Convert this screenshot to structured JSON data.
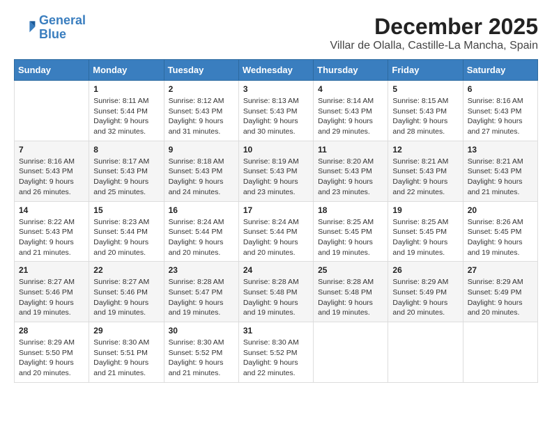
{
  "logo": {
    "line1": "General",
    "line2": "Blue"
  },
  "title": "December 2025",
  "location": "Villar de Olalla, Castille-La Mancha, Spain",
  "days_of_week": [
    "Sunday",
    "Monday",
    "Tuesday",
    "Wednesday",
    "Thursday",
    "Friday",
    "Saturday"
  ],
  "weeks": [
    [
      {
        "day": "",
        "sunrise": "",
        "sunset": "",
        "daylight": ""
      },
      {
        "day": "1",
        "sunrise": "Sunrise: 8:11 AM",
        "sunset": "Sunset: 5:44 PM",
        "daylight": "Daylight: 9 hours and 32 minutes."
      },
      {
        "day": "2",
        "sunrise": "Sunrise: 8:12 AM",
        "sunset": "Sunset: 5:43 PM",
        "daylight": "Daylight: 9 hours and 31 minutes."
      },
      {
        "day": "3",
        "sunrise": "Sunrise: 8:13 AM",
        "sunset": "Sunset: 5:43 PM",
        "daylight": "Daylight: 9 hours and 30 minutes."
      },
      {
        "day": "4",
        "sunrise": "Sunrise: 8:14 AM",
        "sunset": "Sunset: 5:43 PM",
        "daylight": "Daylight: 9 hours and 29 minutes."
      },
      {
        "day": "5",
        "sunrise": "Sunrise: 8:15 AM",
        "sunset": "Sunset: 5:43 PM",
        "daylight": "Daylight: 9 hours and 28 minutes."
      },
      {
        "day": "6",
        "sunrise": "Sunrise: 8:16 AM",
        "sunset": "Sunset: 5:43 PM",
        "daylight": "Daylight: 9 hours and 27 minutes."
      }
    ],
    [
      {
        "day": "7",
        "sunrise": "Sunrise: 8:16 AM",
        "sunset": "Sunset: 5:43 PM",
        "daylight": "Daylight: 9 hours and 26 minutes."
      },
      {
        "day": "8",
        "sunrise": "Sunrise: 8:17 AM",
        "sunset": "Sunset: 5:43 PM",
        "daylight": "Daylight: 9 hours and 25 minutes."
      },
      {
        "day": "9",
        "sunrise": "Sunrise: 8:18 AM",
        "sunset": "Sunset: 5:43 PM",
        "daylight": "Daylight: 9 hours and 24 minutes."
      },
      {
        "day": "10",
        "sunrise": "Sunrise: 8:19 AM",
        "sunset": "Sunset: 5:43 PM",
        "daylight": "Daylight: 9 hours and 23 minutes."
      },
      {
        "day": "11",
        "sunrise": "Sunrise: 8:20 AM",
        "sunset": "Sunset: 5:43 PM",
        "daylight": "Daylight: 9 hours and 23 minutes."
      },
      {
        "day": "12",
        "sunrise": "Sunrise: 8:21 AM",
        "sunset": "Sunset: 5:43 PM",
        "daylight": "Daylight: 9 hours and 22 minutes."
      },
      {
        "day": "13",
        "sunrise": "Sunrise: 8:21 AM",
        "sunset": "Sunset: 5:43 PM",
        "daylight": "Daylight: 9 hours and 21 minutes."
      }
    ],
    [
      {
        "day": "14",
        "sunrise": "Sunrise: 8:22 AM",
        "sunset": "Sunset: 5:43 PM",
        "daylight": "Daylight: 9 hours and 21 minutes."
      },
      {
        "day": "15",
        "sunrise": "Sunrise: 8:23 AM",
        "sunset": "Sunset: 5:44 PM",
        "daylight": "Daylight: 9 hours and 20 minutes."
      },
      {
        "day": "16",
        "sunrise": "Sunrise: 8:24 AM",
        "sunset": "Sunset: 5:44 PM",
        "daylight": "Daylight: 9 hours and 20 minutes."
      },
      {
        "day": "17",
        "sunrise": "Sunrise: 8:24 AM",
        "sunset": "Sunset: 5:44 PM",
        "daylight": "Daylight: 9 hours and 20 minutes."
      },
      {
        "day": "18",
        "sunrise": "Sunrise: 8:25 AM",
        "sunset": "Sunset: 5:45 PM",
        "daylight": "Daylight: 9 hours and 19 minutes."
      },
      {
        "day": "19",
        "sunrise": "Sunrise: 8:25 AM",
        "sunset": "Sunset: 5:45 PM",
        "daylight": "Daylight: 9 hours and 19 minutes."
      },
      {
        "day": "20",
        "sunrise": "Sunrise: 8:26 AM",
        "sunset": "Sunset: 5:45 PM",
        "daylight": "Daylight: 9 hours and 19 minutes."
      }
    ],
    [
      {
        "day": "21",
        "sunrise": "Sunrise: 8:27 AM",
        "sunset": "Sunset: 5:46 PM",
        "daylight": "Daylight: 9 hours and 19 minutes."
      },
      {
        "day": "22",
        "sunrise": "Sunrise: 8:27 AM",
        "sunset": "Sunset: 5:46 PM",
        "daylight": "Daylight: 9 hours and 19 minutes."
      },
      {
        "day": "23",
        "sunrise": "Sunrise: 8:28 AM",
        "sunset": "Sunset: 5:47 PM",
        "daylight": "Daylight: 9 hours and 19 minutes."
      },
      {
        "day": "24",
        "sunrise": "Sunrise: 8:28 AM",
        "sunset": "Sunset: 5:48 PM",
        "daylight": "Daylight: 9 hours and 19 minutes."
      },
      {
        "day": "25",
        "sunrise": "Sunrise: 8:28 AM",
        "sunset": "Sunset: 5:48 PM",
        "daylight": "Daylight: 9 hours and 19 minutes."
      },
      {
        "day": "26",
        "sunrise": "Sunrise: 8:29 AM",
        "sunset": "Sunset: 5:49 PM",
        "daylight": "Daylight: 9 hours and 20 minutes."
      },
      {
        "day": "27",
        "sunrise": "Sunrise: 8:29 AM",
        "sunset": "Sunset: 5:49 PM",
        "daylight": "Daylight: 9 hours and 20 minutes."
      }
    ],
    [
      {
        "day": "28",
        "sunrise": "Sunrise: 8:29 AM",
        "sunset": "Sunset: 5:50 PM",
        "daylight": "Daylight: 9 hours and 20 minutes."
      },
      {
        "day": "29",
        "sunrise": "Sunrise: 8:30 AM",
        "sunset": "Sunset: 5:51 PM",
        "daylight": "Daylight: 9 hours and 21 minutes."
      },
      {
        "day": "30",
        "sunrise": "Sunrise: 8:30 AM",
        "sunset": "Sunset: 5:52 PM",
        "daylight": "Daylight: 9 hours and 21 minutes."
      },
      {
        "day": "31",
        "sunrise": "Sunrise: 8:30 AM",
        "sunset": "Sunset: 5:52 PM",
        "daylight": "Daylight: 9 hours and 22 minutes."
      },
      {
        "day": "",
        "sunrise": "",
        "sunset": "",
        "daylight": ""
      },
      {
        "day": "",
        "sunrise": "",
        "sunset": "",
        "daylight": ""
      },
      {
        "day": "",
        "sunrise": "",
        "sunset": "",
        "daylight": ""
      }
    ]
  ]
}
